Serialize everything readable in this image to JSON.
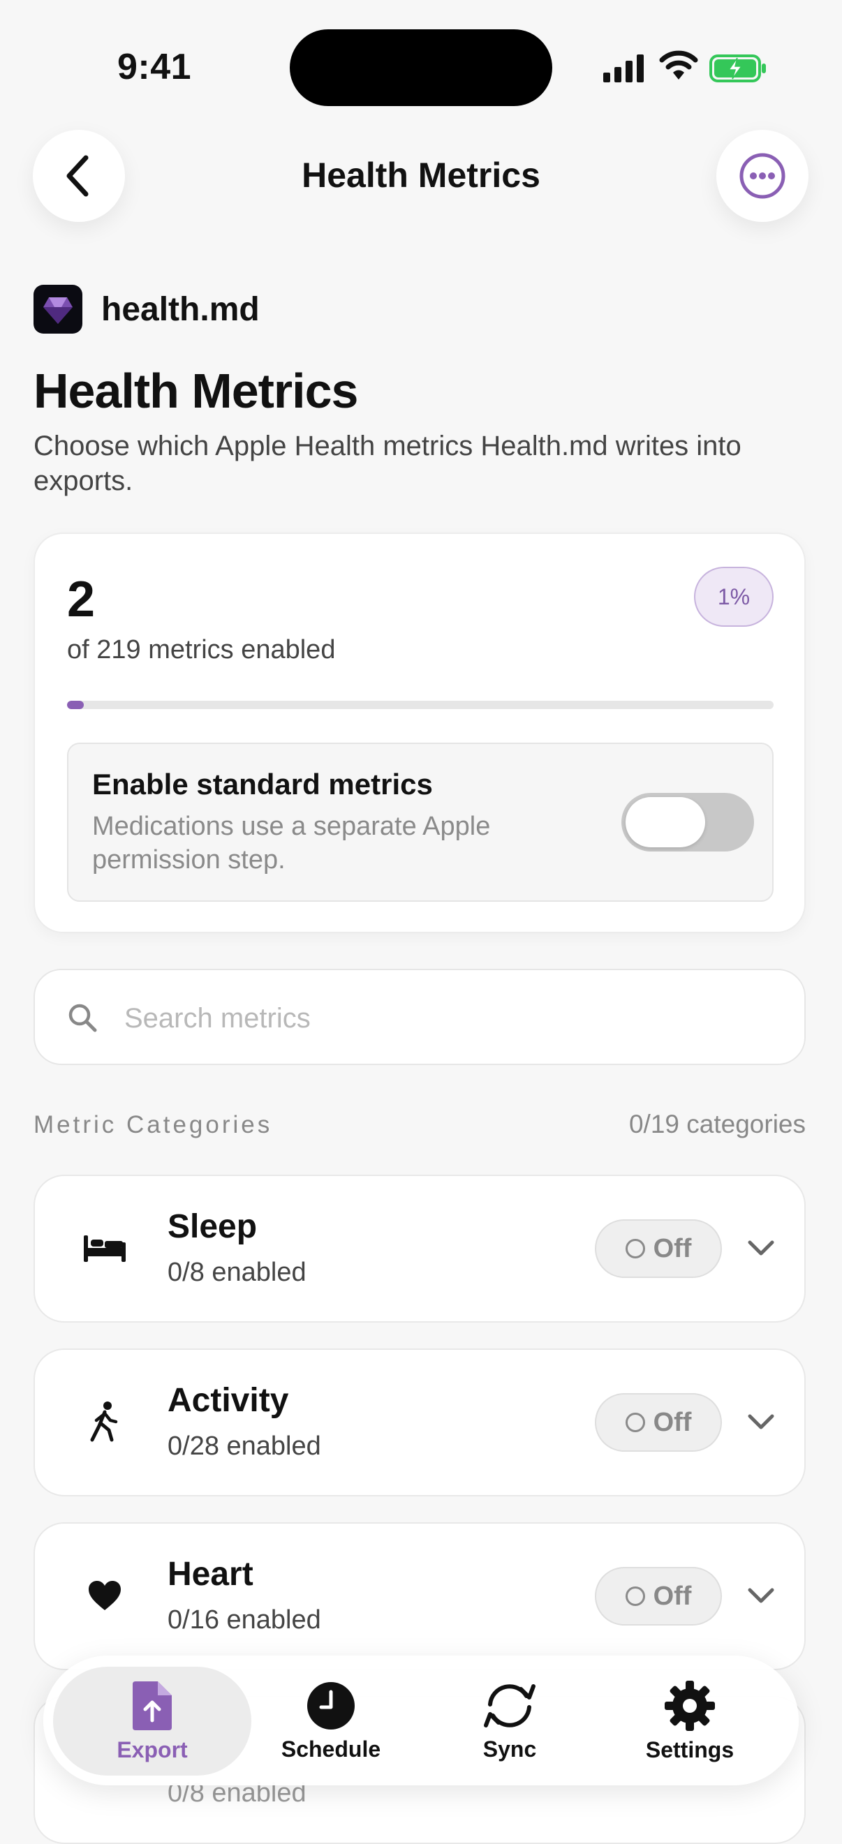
{
  "status": {
    "time": "9:41"
  },
  "nav": {
    "title": "Health Metrics",
    "back_icon": "chevron-left-icon",
    "more_icon": "ellipsis-circle-icon"
  },
  "app": {
    "name": "health.md"
  },
  "page": {
    "title": "Health Metrics",
    "subtitle": "Choose which Apple Health metrics Health.md writes into exports."
  },
  "summary": {
    "count": "2",
    "of_label": "of 219 metrics enabled",
    "percent_label": "1%",
    "progress_fraction": 0.009,
    "standard": {
      "title": "Enable standard metrics",
      "subtitle": "Medications use a separate Apple permission step.",
      "enabled": false
    }
  },
  "search": {
    "placeholder": "Search metrics",
    "value": ""
  },
  "categories": {
    "label": "Metric Categories",
    "count": "0/19 categories",
    "items": [
      {
        "title": "Sleep",
        "subtitle": "0/8 enabled",
        "state": "Off",
        "icon": "bed-icon"
      },
      {
        "title": "Activity",
        "subtitle": "0/28 enabled",
        "state": "Off",
        "icon": "walking-icon"
      },
      {
        "title": "Heart",
        "subtitle": "0/16 enabled",
        "state": "Off",
        "icon": "heart-icon"
      },
      {
        "title": "",
        "subtitle": "0/8 enabled"
      }
    ]
  },
  "tabs": [
    {
      "label": "Export",
      "icon": "export-doc-icon",
      "active": true
    },
    {
      "label": "Schedule",
      "icon": "clock-icon",
      "active": false
    },
    {
      "label": "Sync",
      "icon": "sync-icon",
      "active": false
    },
    {
      "label": "Settings",
      "icon": "gear-icon",
      "active": false
    }
  ],
  "colors": {
    "accent": "#8a5fb4",
    "battery": "#34c759"
  }
}
